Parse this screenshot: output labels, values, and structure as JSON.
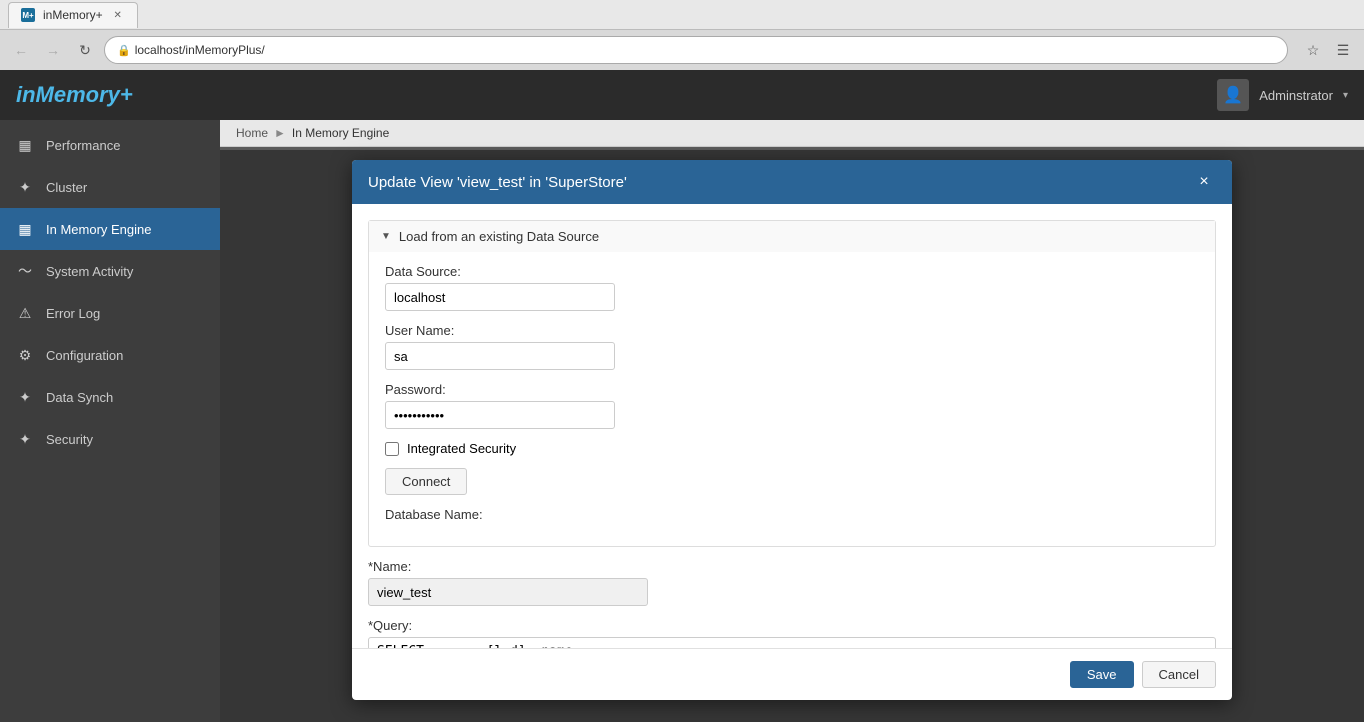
{
  "browser": {
    "tab_title": "inMemory+",
    "tab_favicon": "M+",
    "address": "localhost/inMemoryPlus/",
    "back_disabled": true,
    "forward_disabled": true
  },
  "app": {
    "logo": "inMemory+",
    "user_label": "Adminstrator",
    "user_dropdown": "▾"
  },
  "breadcrumb": {
    "home": "Home",
    "current": "In Memory Engine"
  },
  "sidebar": {
    "items": [
      {
        "id": "performance",
        "label": "Performance",
        "icon": "▦",
        "active": false
      },
      {
        "id": "cluster",
        "label": "Cluster",
        "icon": "✦",
        "active": false
      },
      {
        "id": "in-memory-engine",
        "label": "In Memory Engine",
        "icon": "▦",
        "active": true
      },
      {
        "id": "system-activity",
        "label": "System Activity",
        "icon": "〜",
        "active": false
      },
      {
        "id": "error-log",
        "label": "Error Log",
        "icon": "⚠",
        "active": false
      },
      {
        "id": "configuration",
        "label": "Configuration",
        "icon": "⚙",
        "active": false
      },
      {
        "id": "data-synch",
        "label": "Data Synch",
        "icon": "✦",
        "active": false
      },
      {
        "id": "security",
        "label": "Security",
        "icon": "✦",
        "active": false
      }
    ]
  },
  "modal": {
    "title": "Update View 'view_test' in 'SuperStore'",
    "close_label": "×",
    "section_label": "Load from an existing Data Source",
    "data_source_label": "Data Source:",
    "data_source_value": "localhost",
    "user_name_label": "User Name:",
    "user_name_value": "sa",
    "password_label": "Password:",
    "password_value": "••••••••••",
    "integrated_security_label": "Integrated Security",
    "connect_label": "Connect",
    "database_name_label": "Database Name:",
    "name_label": "*Name:",
    "name_value": "view_test",
    "query_label": "*Query:",
    "query_value": "SELECT        [l.d], name",
    "save_label": "Save",
    "cancel_label": "Cancel"
  }
}
